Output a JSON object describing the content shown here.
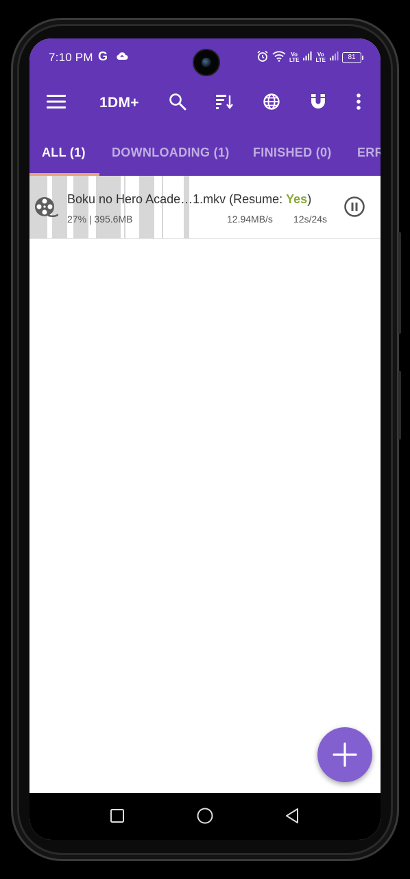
{
  "status_bar": {
    "time": "7:10 PM",
    "g_label": "G",
    "volte1": "Vo\nLTE",
    "volte2": "Vo\nLTE",
    "battery": "81"
  },
  "toolbar": {
    "title": "1DM+"
  },
  "tabs": [
    {
      "label": "ALL (1)"
    },
    {
      "label": "DOWNLOADING (1)"
    },
    {
      "label": "FINISHED (0)"
    },
    {
      "label": "ERR"
    }
  ],
  "downloads": [
    {
      "name_prefix": "Boku no Hero Acade…1.mkv (Resume: ",
      "resume_value": "Yes",
      "name_suffix": ")",
      "progress_size": "27% | 395.6MB",
      "progress_fraction": 0.27,
      "speed": "12.94MB/s",
      "time": "12s/24s"
    }
  ],
  "colors": {
    "appbar": "#6236b5",
    "fab": "#8360cf",
    "tab_indicator": "#e9a27a",
    "resume_yes": "#8aa838"
  }
}
